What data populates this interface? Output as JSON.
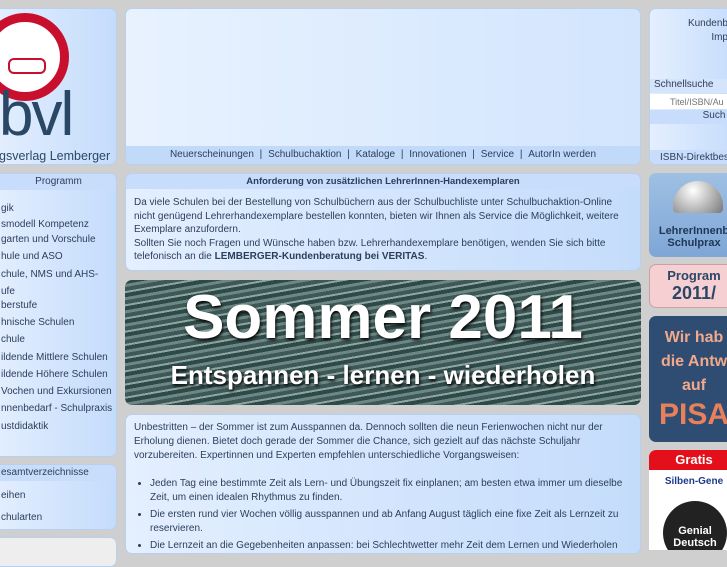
{
  "logo": {
    "letters": "bvl",
    "tagline": "gsverlag Lemberger"
  },
  "nav": [
    "Neuerscheinungen",
    "Schulbuchaktion",
    "Kataloge",
    "Innovationen",
    "Service",
    "AutorIn werden"
  ],
  "sidebar": {
    "program_title": "Programm",
    "program_items": [
      "gik",
      "smodell Kompetenz",
      "garten und Vorschule",
      "hule und ASO",
      "chule, NMS und AHS-",
      "ufe",
      "berstufe",
      "hnische Schulen",
      "chule",
      "ildende Mittlere Schulen",
      "ildende Höhere Schulen",
      "Vochen und Exkursionen",
      "nnenbedarf - Schulpraxis",
      "ustdidaktik"
    ],
    "catalog_title": "esamtverzeichnisse",
    "catalog_items": [
      "eihen",
      "chularten"
    ]
  },
  "notice": {
    "title": "Anforderung von zusätzlichen LehrerInnen-Handexemplaren",
    "p1": "Da viele Schulen bei der Bestellung von Schulbüchern aus der Schulbuchliste unter Schulbuchaktion-Online nicht genügend Lehrerhandexemplare bestellen konnten, bieten wir Ihnen als Service die Möglichkeit, weitere Exemplare anzufordern.",
    "p2": "Sollten Sie noch Fragen und Wünsche haben bzw. Lehrerhandexemplare benötigen, wenden Sie sich bitte telefonisch an die ",
    "p2_bold": "LEMBERGER-Kundenberatung bei VERITAS",
    "p2_end": "."
  },
  "banner": {
    "title": "Sommer 2011",
    "subtitle": "Entspannen - lernen - wiederholen"
  },
  "article": {
    "intro": "Unbestritten – der Sommer ist zum Ausspannen da. Dennoch sollten die neun Ferienwochen nicht nur der Erholung dienen. Bietet doch gerade der Sommer die Chance, sich gezielt auf das nächste Schuljahr vorzubereiten. Expertinnen und Experten empfehlen unterschiedliche Vorgangsweisen:",
    "bullets": [
      "Jeden Tag eine bestimmte Zeit als Lern- und Übungszeit fix einplanen; am besten etwa immer um dieselbe Zeit, um einen idealen Rhythmus zu finden.",
      "Die ersten rund vier Wochen völlig ausspannen und ab Anfang August täglich eine fixe Zeit als Lernzeit zu reservieren.",
      "Die Lernzeit an die Gegebenheiten anpassen: bei Schlechtwetter mehr Zeit dem Lernen und Wiederholen"
    ]
  },
  "right": {
    "links": [
      "Kundenb",
      "Imp"
    ],
    "search_label": "Schnellsuche",
    "search_placeholder": "Titel/ISBN/Au",
    "search_button": "Such",
    "isbn": "ISBN-Direktbest",
    "bell_line1": "LehrerInnenb",
    "bell_line2": "Schulprax",
    "prog_line1": "Program",
    "prog_line2": "2011/",
    "pisa": [
      "Wir hab",
      "die Antw",
      "auf",
      "PISA"
    ],
    "gratis": "Gratis",
    "silben": "Silben-Gene",
    "genial": "Genial Deutsch"
  },
  "colors": {
    "accent_red": "#c8102e",
    "panel_blue": "#c8ddfb",
    "pisa_bg": "#2f4c73"
  }
}
